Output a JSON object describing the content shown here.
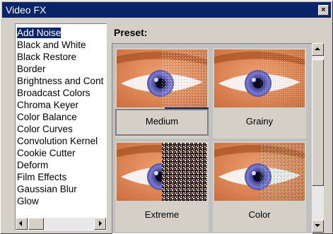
{
  "window": {
    "title": "Video FX",
    "close_label": "×"
  },
  "effects": {
    "selected_index": 0,
    "items": [
      "Add Noise",
      "Black and White",
      "Black Restore",
      "Border",
      "Brightness and Cont",
      "Broadcast Colors",
      "Chroma Keyer",
      "Color Balance",
      "Color Curves",
      "Convolution Kernel",
      "Cookie Cutter",
      "Deform",
      "Film Effects",
      "Gaussian Blur",
      "Glow"
    ]
  },
  "preset": {
    "label": "Preset:",
    "items": [
      {
        "label": "Medium",
        "selected": true
      },
      {
        "label": "Grainy",
        "selected": false
      },
      {
        "label": "Extreme",
        "selected": false
      },
      {
        "label": "Color",
        "selected": false
      }
    ]
  },
  "colors": {
    "titlebar": "#0a246a",
    "selection": "#0a246a",
    "face": "#d4d0c8"
  }
}
